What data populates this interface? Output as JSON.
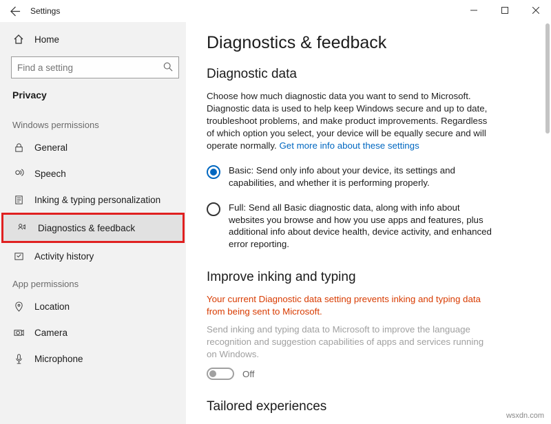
{
  "titlebar": {
    "app_title": "Settings"
  },
  "sidebar": {
    "home": "Home",
    "search_placeholder": "Find a setting",
    "category": "Privacy",
    "group_windows": "Windows permissions",
    "items_win": [
      {
        "label": "General"
      },
      {
        "label": "Speech"
      },
      {
        "label": "Inking & typing personalization"
      },
      {
        "label": "Diagnostics & feedback"
      },
      {
        "label": "Activity history"
      }
    ],
    "group_app": "App permissions",
    "items_app": [
      {
        "label": "Location"
      },
      {
        "label": "Camera"
      },
      {
        "label": "Microphone"
      }
    ]
  },
  "content": {
    "page_title": "Diagnostics & feedback",
    "diag_heading": "Diagnostic data",
    "diag_body": "Choose how much diagnostic data you want to send to Microsoft. Diagnostic data is used to help keep Windows secure and up to date, troubleshoot problems, and make product improvements. Regardless of which option you select, your device will be equally secure and will operate normally. ",
    "diag_link": "Get more info about these settings",
    "radio_basic": "Basic: Send only info about your device, its settings and capabilities, and whether it is performing properly.",
    "radio_full": "Full: Send all Basic diagnostic data, along with info about websites you browse and how you use apps and features, plus additional info about device health, device activity, and enhanced error reporting.",
    "inking_heading": "Improve inking and typing",
    "inking_warn": "Your current Diagnostic data setting prevents inking and typing data from being sent to Microsoft.",
    "inking_desc": "Send inking and typing data to Microsoft to improve the language recognition and suggestion capabilities of apps and services running on Windows.",
    "toggle_off": "Off",
    "tailored_heading": "Tailored experiences"
  },
  "watermark": "wsxdn.com"
}
